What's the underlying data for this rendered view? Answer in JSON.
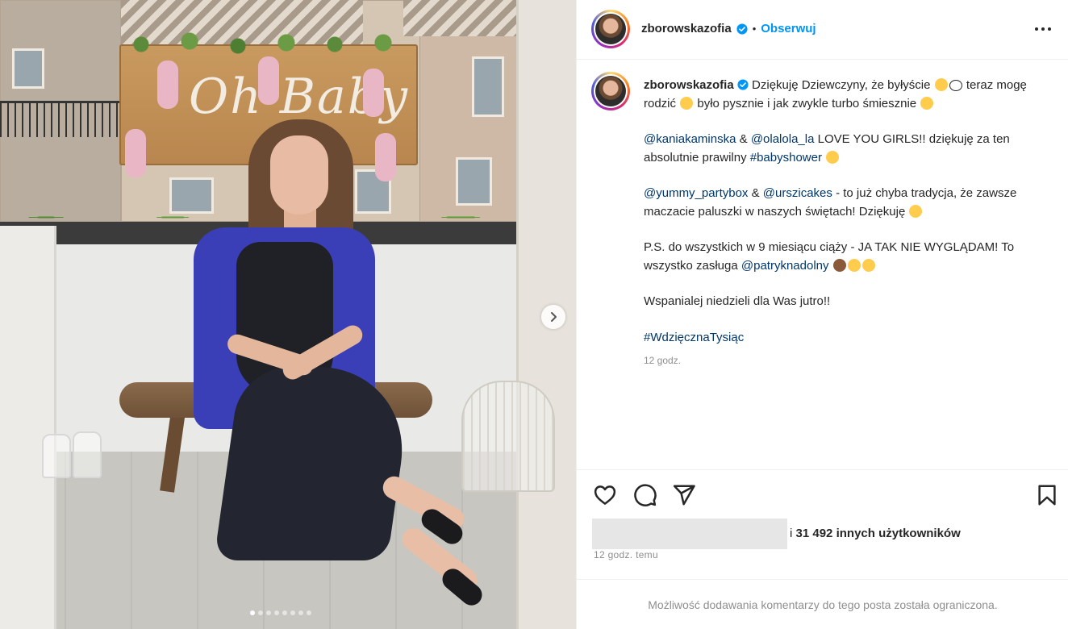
{
  "photo": {
    "sign_text": "Oh Baby",
    "carousel_dots": 8,
    "carousel_active": 0
  },
  "header": {
    "username": "zborowskazofia",
    "separator": "•",
    "follow_label": "Obserwuj"
  },
  "caption": {
    "username": "zborowskazofia",
    "p1_text_a": "Dziękuję Dziewczyny, że byłyście",
    "p1_text_b": "teraz mogę rodzić",
    "p1_text_c": "było pysznie i jak zwykle turbo śmiesznie",
    "p2_mention1": "@kaniakaminska",
    "p2_amp": "&",
    "p2_mention2": "@olalola_la",
    "p2_text": "LOVE YOU GIRLS!! dziękuję za ten absolutnie prawilny",
    "p2_hashtag": "#babyshower",
    "p3_mention1": "@yummy_partybox",
    "p3_amp": "&",
    "p3_mention2": "@urszicakes",
    "p3_text": "- to już chyba tradycja, że zawsze maczacie paluszki w naszych świętach! Dziękuję",
    "p4_text": "P.S. do wszystkich w 9 miesiącu ciąży - JA TAK NIE WYGLĄDAM! To wszystko zasługa",
    "p4_mention": "@patryknadolny",
    "p5_text": "Wspanialej niedzieli dla Was jutro!!",
    "p6_hashtag": "#WdzięcznaTysiąc",
    "time": "12 godz."
  },
  "actions": {
    "likes_prefix": "i",
    "likes_count": "31 492",
    "likes_suffix": "innych użytkowników",
    "post_time": "12 godz. temu"
  },
  "comments": {
    "disabled_text": "Możliwość dodawania komentarzy do tego posta została ograniczona."
  },
  "colors": {
    "accent": "#0095f6",
    "link": "#00376b",
    "muted": "#8e8e8e"
  },
  "icons": [
    "verified-icon",
    "more-options-icon",
    "heart-icon",
    "comment-icon",
    "share-icon",
    "bookmark-icon",
    "chevron-right-icon"
  ]
}
